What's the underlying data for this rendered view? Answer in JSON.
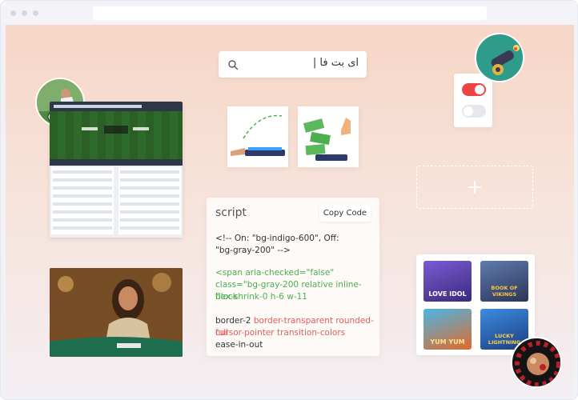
{
  "search": {
    "value": "ای بت فا |"
  },
  "code_card": {
    "title": "script",
    "copy_label": "Copy Code",
    "lines": [
      {
        "text": "<!-- On: \"bg-indigo-600\", Off:",
        "color": "#333333"
      },
      {
        "text": "\"bg-gray-200\" -->",
        "color": "#333333"
      },
      {
        "text": "<span aria-checked=\"false\"",
        "color": "#4caf50"
      },
      {
        "text": "class=\"bg-gray-200 relative inline-block",
        "color": "#4caf50"
      },
      {
        "text": "flex-shrink-0 h-6 w-11",
        "color": "#4caf50"
      },
      {
        "text_plain": "border-2 ",
        "text_accent": "border-transparent rounded-full",
        "color": "#333333",
        "accent": "#e35d5d"
      },
      {
        "text": "cursor-pointer transition-colors",
        "color": "#e35d5d"
      },
      {
        "text": "ease-in-out",
        "color": "#333333"
      }
    ]
  },
  "toggles": {
    "on_color": "#ef4444",
    "off_color": "#e7e7ee",
    "states": [
      "on",
      "off"
    ]
  },
  "games": [
    {
      "title": "LOVE IDOL",
      "color": "#5b3fa6"
    },
    {
      "title": "BOOK OF VIKINGS",
      "color": "#3b4b7a"
    },
    {
      "title": "YUM YUM",
      "color": "#2b8fc2"
    },
    {
      "title": "LUCKY LIGHTNING",
      "color": "#2e6fb8"
    }
  ],
  "colors": {
    "accent": "#ef4444",
    "background_top": "#f6d6c6",
    "background_bottom": "#f4eef3"
  },
  "icons": [
    "search-icon",
    "plus-icon",
    "cannon-icon",
    "roulette-icon",
    "soccer-icon"
  ]
}
